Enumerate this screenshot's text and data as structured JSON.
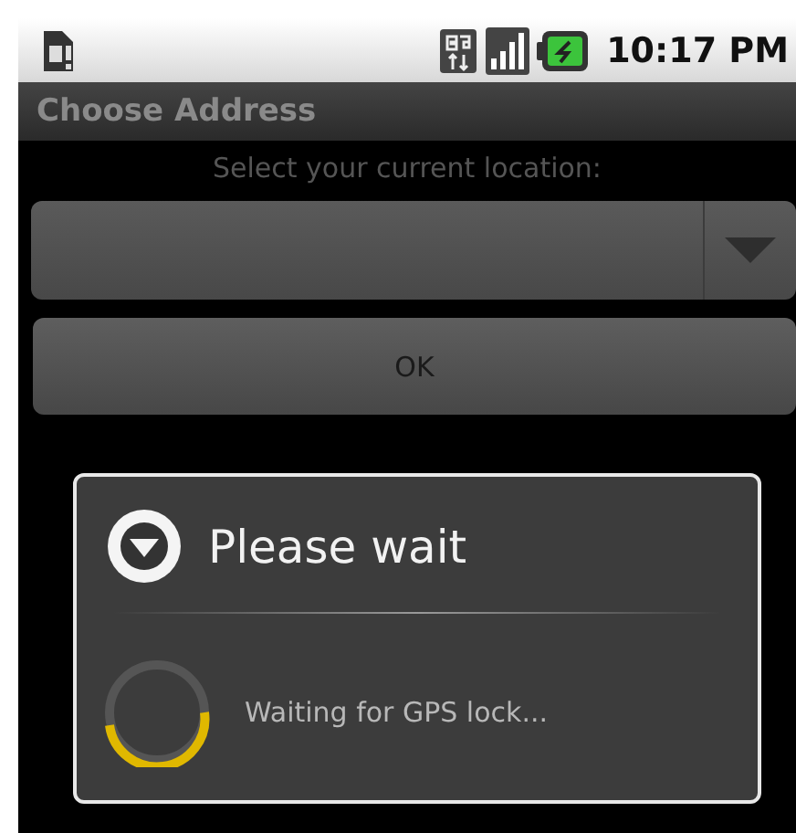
{
  "status_bar": {
    "time": "10:17 PM"
  },
  "title_bar": {
    "title": "Choose Address"
  },
  "location": {
    "label": "Select your current location:"
  },
  "ok_button": {
    "label": "OK"
  },
  "dialog": {
    "title": "Please wait",
    "message": "Waiting for GPS lock..."
  }
}
